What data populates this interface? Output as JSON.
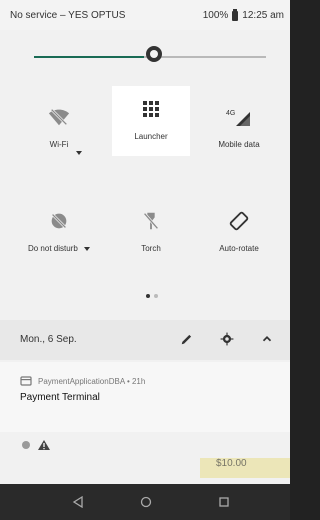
{
  "statusbar": {
    "carrier": "No service – YES OPTUS",
    "battery": "100%",
    "time": "12:25 am"
  },
  "brightness": {
    "level": 0.5
  },
  "quick_settings": {
    "tiles": [
      {
        "label": "Wi-Fi",
        "icon": "wifi-off-icon"
      },
      {
        "label": "Launcher",
        "icon": "apps-grid-icon"
      },
      {
        "label": "Mobile data",
        "icon": "mobile-data-icon"
      },
      {
        "label": "Do not disturb",
        "icon": "dnd-icon"
      },
      {
        "label": "Torch",
        "icon": "flashlight-icon"
      },
      {
        "label": "Auto-rotate",
        "icon": "rotate-icon"
      }
    ]
  },
  "footer": {
    "date": "Mon., 6 Sep."
  },
  "notification": {
    "app": "PaymentApplicationDBA • 21h",
    "title": "Payment Terminal"
  },
  "background": {
    "amount": "$10.00"
  }
}
